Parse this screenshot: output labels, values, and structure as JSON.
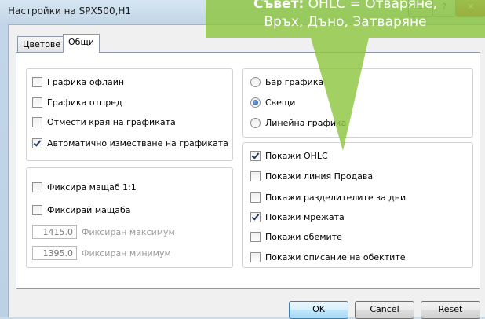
{
  "window": {
    "title": "Настройки на SPX500,H1",
    "controls": {
      "minimize": "▭",
      "help": "?",
      "close": "✕"
    }
  },
  "tabs": [
    {
      "label": "Цветове",
      "active": false
    },
    {
      "label": "Общи",
      "active": true
    }
  ],
  "left_group1": [
    {
      "label": "Графика офлайн",
      "checked": false
    },
    {
      "label": "Графика отпред",
      "checked": false
    },
    {
      "label": "Отмести края на графиката",
      "checked": false
    },
    {
      "label": "Автоматично изместване на графиката",
      "checked": true
    }
  ],
  "left_group2": {
    "fix_scale_11": {
      "label": "Фиксира мащаб 1:1",
      "checked": false
    },
    "fix_scale": {
      "label": "Фиксирай мащаба",
      "checked": false
    },
    "max": {
      "value": "1415.0",
      "label": "Фиксиран максимум"
    },
    "min": {
      "value": "1395.0",
      "label": "Фиксиран минимум"
    }
  },
  "chart_type": [
    {
      "label": "Бар графика",
      "checked": false
    },
    {
      "label": "Свещи",
      "checked": true
    },
    {
      "label": "Линейна графика",
      "checked": false
    }
  ],
  "show_options": [
    {
      "label": "Покажи OHLC",
      "checked": true
    },
    {
      "label": "Покажи линия Продава",
      "checked": false
    },
    {
      "label": "Покажи разделителите за дни",
      "checked": false
    },
    {
      "label": "Покажи мрежата",
      "checked": true
    },
    {
      "label": "Покажи обемите",
      "checked": false
    },
    {
      "label": "Покажи описание на обектите",
      "checked": false
    }
  ],
  "buttons": {
    "ok": "OK",
    "cancel": "Cancel",
    "reset": "Reset"
  },
  "callout": {
    "heading": "Съвет:",
    "line1": "OHLC = Отваряне,",
    "line2": "Връх, Дъно, Затваряне",
    "color": "#8dc63f"
  }
}
